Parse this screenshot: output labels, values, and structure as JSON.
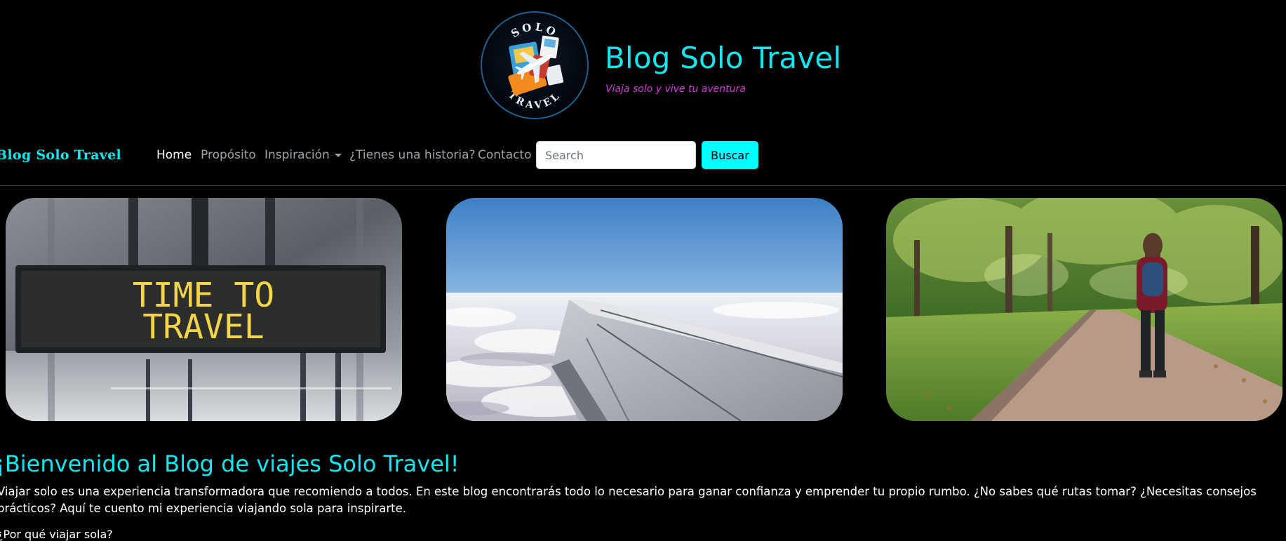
{
  "header": {
    "logo": {
      "top_text": "SOLO",
      "bottom_text": "TRAVEL",
      "alt": "Solo Travel logo"
    },
    "title": "Blog Solo Travel",
    "tagline": "Viaja solo y vive tu aventura"
  },
  "navbar": {
    "brand": "Blog Solo Travel",
    "items": [
      {
        "label": "Home",
        "active": true
      },
      {
        "label": "Propósito",
        "active": false
      },
      {
        "label": "Inspiración",
        "active": false,
        "dropdown": true
      },
      {
        "label": "¿Tienes una historia?",
        "active": false
      },
      {
        "label": "Contacto",
        "active": false
      }
    ],
    "search": {
      "placeholder": "Search",
      "value": ""
    },
    "search_button": "Buscar"
  },
  "gallery": {
    "images": [
      {
        "alt": "Departure board",
        "sign_line1": "TIME TO",
        "sign_line2": "TRAVEL"
      },
      {
        "alt": "Airplane wing above clouds"
      },
      {
        "alt": "Woman walking on a park path"
      }
    ]
  },
  "main": {
    "welcome_title": "¡Bienvenido al Blog de viajes Solo Travel!",
    "intro": "Viajar solo es una experiencia transformadora que recomiendo a todos. En este blog encontrarás todo lo necesario para ganar confianza y emprender tu propio rumbo. ¿No sabes qué rutas tomar? ¿Necesitas consejos prácticos? Aquí te cuento mi experiencia viajando sola para inspirarte.",
    "next_heading_partial": "¿Por qué viajar sola?"
  },
  "colors": {
    "accent": "#14e6f0",
    "tagline": "#d040d8",
    "button": "#00ffff",
    "background": "#000000"
  }
}
